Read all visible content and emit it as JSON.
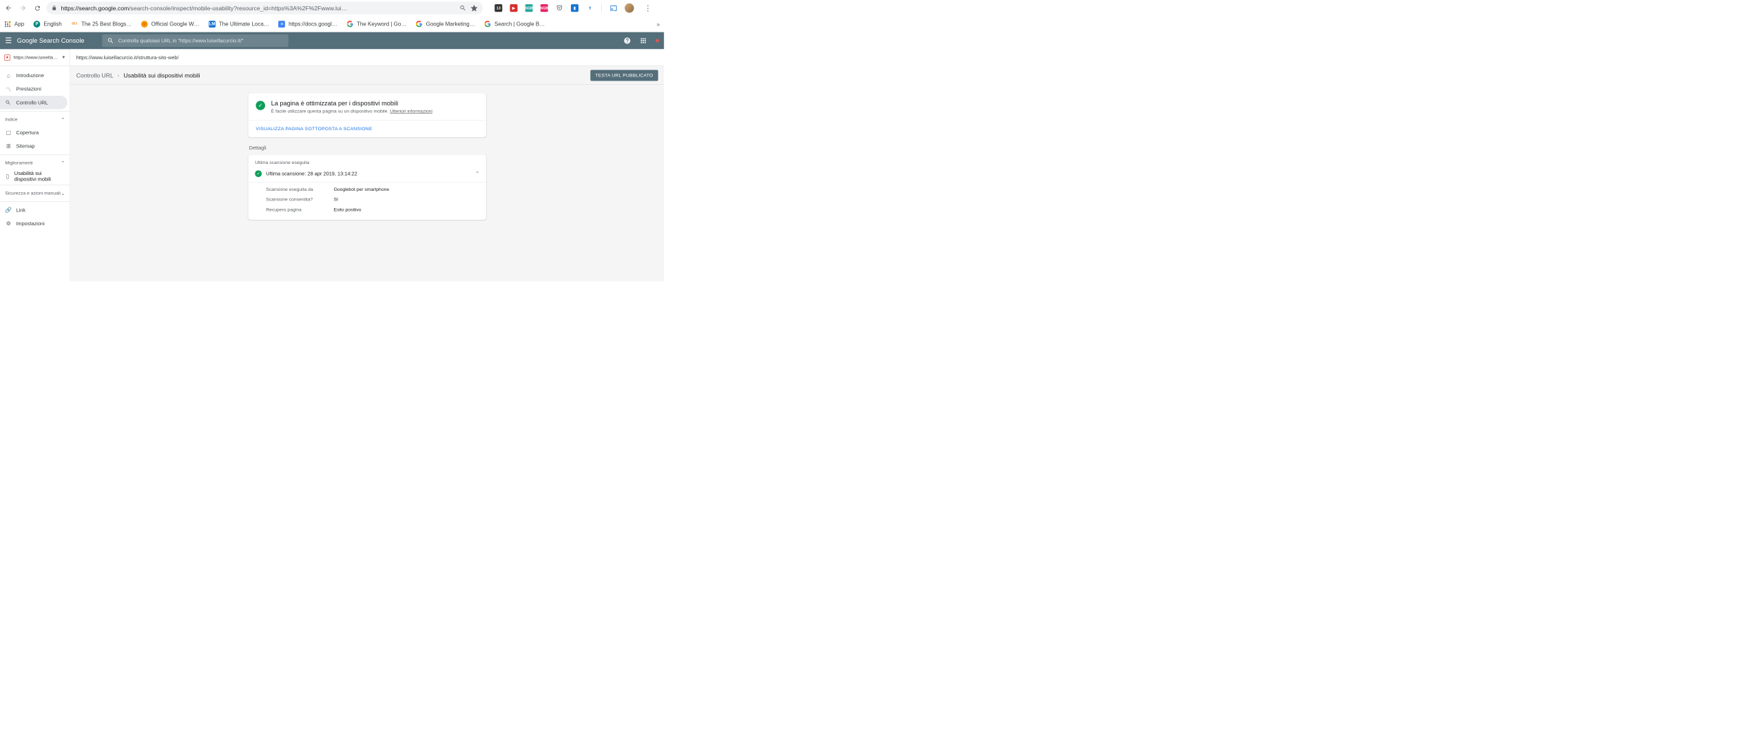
{
  "chrome": {
    "url_bold": "search.google.com",
    "url_rest": "/search-console/inspect/mobile-usability?resource_id=https%3A%2F%2Fwww.lui…",
    "badge": "13"
  },
  "bookmarks": {
    "b0": "App",
    "b1": "English",
    "b2": "The 25 Best Blogs…",
    "b3": "Official Google W…",
    "b4": "The Ultimate Loca…",
    "b5": "https://docs.googl…",
    "b6": "The Keyword | Go…",
    "b7": "Google Marketing…",
    "b8": "Search | Google B…"
  },
  "header": {
    "logo_g": "Google",
    "logo_sc": "Search Console",
    "search_placeholder": "Controlla qualsiasi URL in \"https://www.luisellacurcio.it/\""
  },
  "sidebar": {
    "property": "https://www.luisellacurcio.it/",
    "intro": "Introduzione",
    "perf": "Prestazioni",
    "inspect": "Controllo URL",
    "index": "Indice",
    "coverage": "Copertura",
    "sitemap": "Sitemap",
    "enhance": "Miglioramenti",
    "mobile": "Usabilità sui dispositivi mobili",
    "security": "Sicurezza e azioni manuali",
    "link": "Link",
    "settings": "Impostazioni"
  },
  "content": {
    "url": "https://www.luisellacurcio.it/struttura-sito-web/",
    "bc1": "Controllo URL",
    "bc2": "Usabilità sui dispositivi mobili",
    "test_btn": "TESTA URL PUBBLICATO",
    "card_title": "La pagina è ottimizzata per i dispositivi mobili",
    "card_sub_a": "È facile utilizzare questa pagina su un dispositivo mobile. ",
    "card_sub_link": "Ulteriori informazioni",
    "card_action": "VISUALIZZA PAGINA SOTTOPOSTA A SCANSIONE",
    "details": "Dettagli",
    "last_crawl_label": "Ultima scansione eseguita",
    "last_crawl_row": "Ultima scansione: 28 apr 2019, 13:14:22",
    "kv1_k": "Scansione eseguita da",
    "kv1_v": "Googlebot per smartphone",
    "kv2_k": "Scansione consentita?",
    "kv2_v": "Sì",
    "kv3_k": "Recupero pagina",
    "kv3_v": "Esito positivo"
  }
}
